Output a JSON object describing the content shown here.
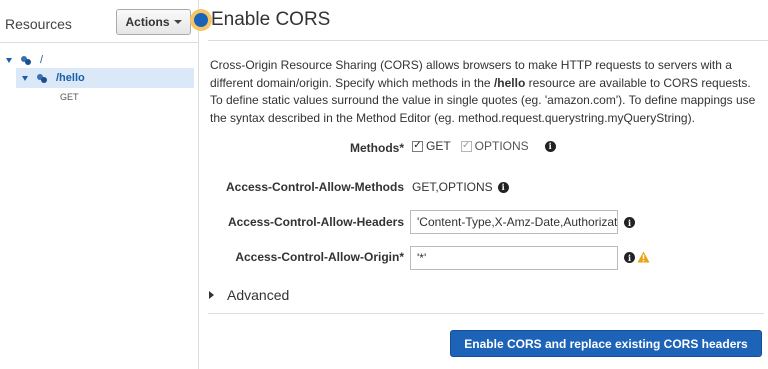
{
  "sidebar": {
    "title": "Resources",
    "actions_label": "Actions",
    "tree": {
      "root": "/",
      "hello": "/hello",
      "get": "GET"
    }
  },
  "main": {
    "title": "Enable CORS",
    "description": {
      "part1": "Cross-Origin Resource Sharing (CORS) allows browsers to make HTTP requests to servers with a different domain/origin. Specify which methods in the ",
      "resource": "/hello",
      "part2": " resource are available to CORS requests. To define static values surround the value in single quotes (eg. 'amazon.com'). To define mappings use the syntax described in the Method Editor (eg. method.request.querystring.myQueryString)."
    },
    "form": {
      "methods_label": "Methods*",
      "method_get": "GET",
      "method_options": "OPTIONS",
      "get_checked": true,
      "options_checked": true,
      "acam_label": "Access-Control-Allow-Methods",
      "acam_value": "GET,OPTIONS",
      "acah_label": "Access-Control-Allow-Headers",
      "acah_value": "'Content-Type,X-Amz-Date,Authorizatio",
      "acao_label": "Access-Control-Allow-Origin*",
      "acao_value": "'*'"
    },
    "advanced_label": "Advanced",
    "submit_label": "Enable CORS and replace existing CORS headers"
  },
  "colors": {
    "accent": "#1d63b8",
    "selected_row": "#dbe8f7",
    "warning": "#e8a317",
    "indicator_ring": "#f7c566"
  },
  "icons": [
    "resource-icon",
    "info-icon",
    "warning-icon",
    "caret-down-icon",
    "expand-triangle-icon"
  ]
}
